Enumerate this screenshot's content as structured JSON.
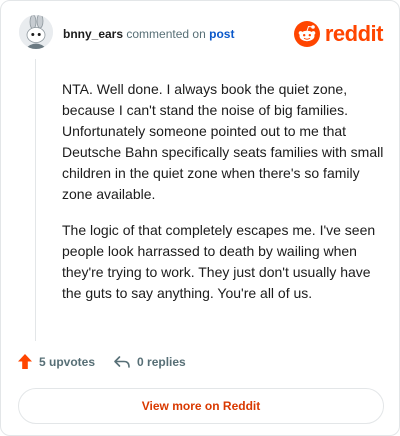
{
  "header": {
    "username": "bnny_ears",
    "action_text": "commented on",
    "post_link": "post"
  },
  "brand": {
    "wordmark": "reddit",
    "color": "#ff4500"
  },
  "comment": {
    "paragraphs": [
      "NTA. Well done. I always book the quiet zone, because I can't stand the noise of big families. Unfortunately someone pointed out to me that Deutsche Bahn specifically seats families with small children in the quiet zone when there's so family zone available.",
      "The logic of that completely escapes me. I've seen people look harrassed to death by wailing when they're trying to work. They just don't usually have the guts to say anything. You're all of us."
    ]
  },
  "actions": {
    "upvotes": "5 upvotes",
    "replies": "0 replies"
  },
  "footer": {
    "button_label": "View more on Reddit"
  }
}
